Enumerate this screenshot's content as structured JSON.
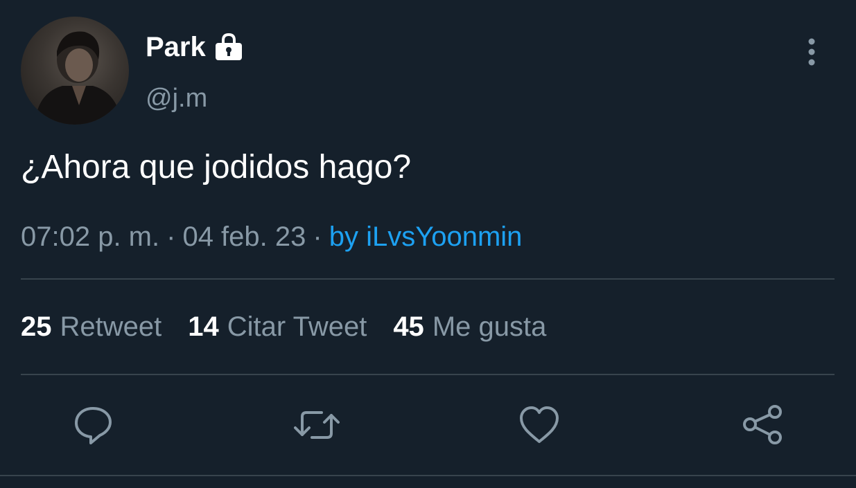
{
  "user": {
    "display_name": "Park",
    "handle": "@j.m"
  },
  "tweet": {
    "text": "¿Ahora que jodidos hago?",
    "time": "07:02 p. m.",
    "date": "04 feb. 23",
    "via": "by iLvsYoonmin",
    "separator": "·"
  },
  "stats": {
    "retweets": {
      "count": "25",
      "label": "Retweet"
    },
    "quotes": {
      "count": "14",
      "label": "Citar Tweet"
    },
    "likes": {
      "count": "45",
      "label": "Me gusta"
    }
  },
  "icons": {
    "verified": "lock-icon",
    "more": "more-vertical-icon",
    "reply": "reply-icon",
    "retweet": "retweet-icon",
    "like": "heart-icon",
    "share": "share-icon"
  },
  "colors": {
    "background": "#15202b",
    "text": "#ffffff",
    "muted": "#8899a6",
    "accent": "#1da1f2",
    "divider": "#38444d"
  }
}
